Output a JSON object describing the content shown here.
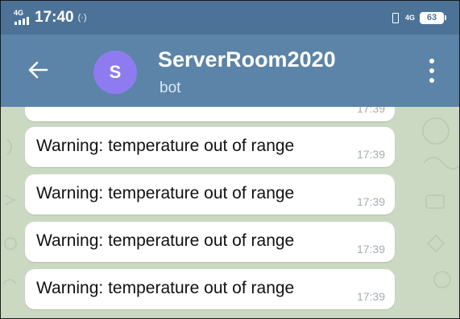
{
  "status_bar": {
    "network": "4G",
    "time": "17:40",
    "network_right": "4G",
    "battery": "63"
  },
  "header": {
    "avatar_letter": "S",
    "title": "ServerRoom2020",
    "subtitle": "bot",
    "avatar_color": "#8f7bf0",
    "bar_color": "#5b84a8"
  },
  "messages": [
    {
      "text": "",
      "time": "17:39"
    },
    {
      "text": "Warning: temperature out of range",
      "time": "17:39"
    },
    {
      "text": "Warning: temperature out of range",
      "time": "17:39"
    },
    {
      "text": "Warning: temperature out of range",
      "time": "17:39"
    },
    {
      "text": "Warning: temperature out of range",
      "time": "17:39"
    }
  ],
  "icons": {
    "back": "arrow-left-icon",
    "menu": "more-vertical-icon",
    "vibrate": "vibrate-icon",
    "battery": "battery-icon",
    "signal": "signal-icon"
  }
}
